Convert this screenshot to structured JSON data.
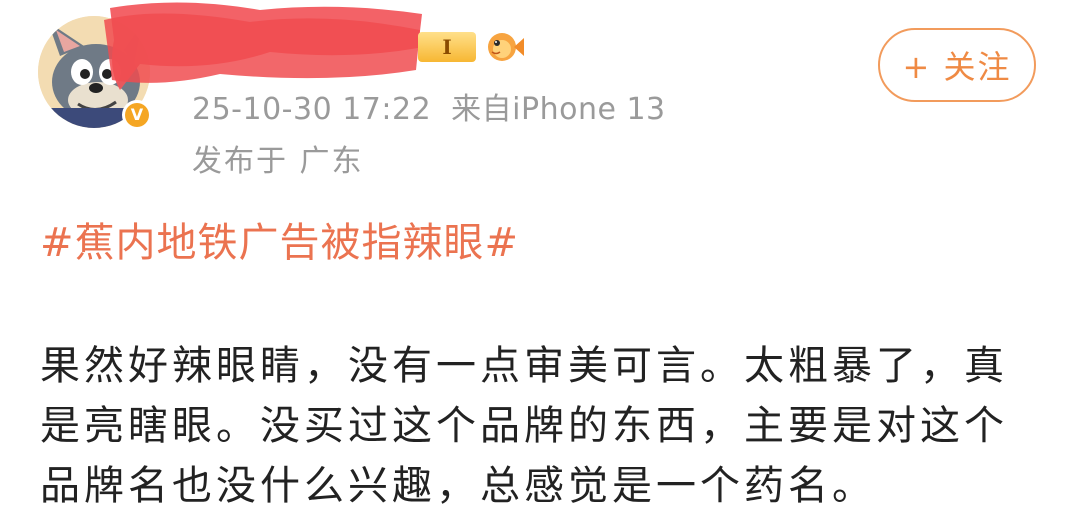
{
  "post": {
    "meta": {
      "date": "25-10-30 17:22",
      "source_prefix": "来自",
      "device": "iPhone 13"
    },
    "location": "发布于 广东",
    "follow_button": {
      "label": "+ 关注"
    },
    "level_badge": "I",
    "topic": "#蕉内地铁广告被指辣眼#",
    "content_lines": [
      "果然好辣眼睛，没有一点审美可言。太粗暴了，真",
      "是亮瞎眼。没买过这个品牌的东西，主要是对这个",
      "品牌名也没什么兴趣，总感觉是一个药名。"
    ],
    "colors": {
      "topic": "#eb7350",
      "follow": "#ef8a44",
      "meta": "#9a9a9a",
      "redaction": "#f2555a",
      "verified": "#f5a623"
    },
    "icons": [
      "avatar",
      "verified-badge-icon",
      "level-badge-icon",
      "fish-badge-icon"
    ]
  }
}
